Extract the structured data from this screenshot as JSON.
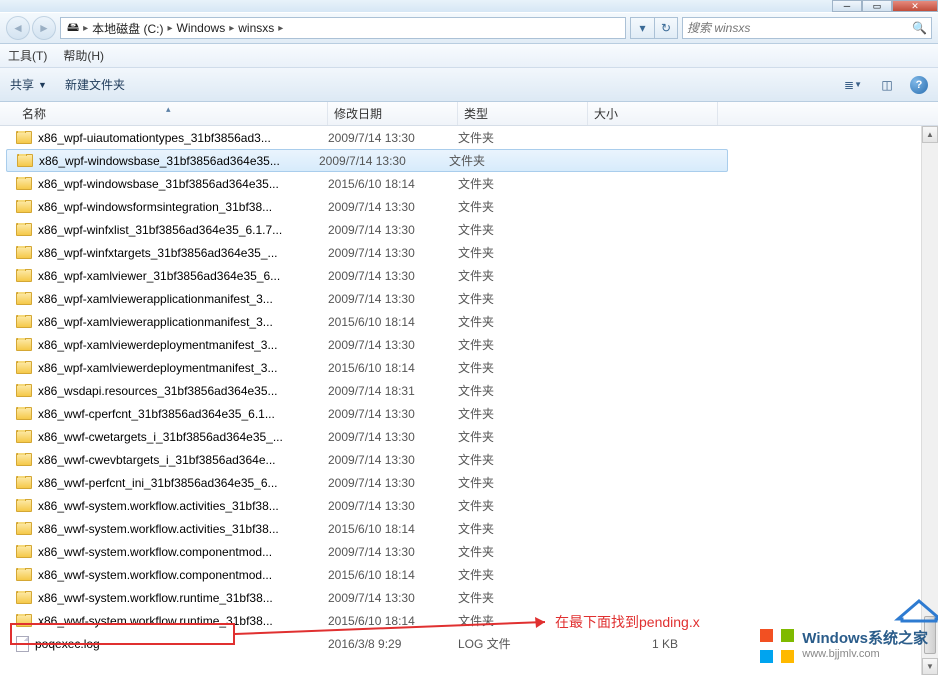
{
  "breadcrumb": {
    "seg1": "本地磁盘 (C:)",
    "seg2": "Windows",
    "seg3": "winsxs"
  },
  "search": {
    "placeholder": "搜索 winsxs"
  },
  "menu": {
    "tools": "工具(T)",
    "help": "帮助(H)"
  },
  "toolbar": {
    "share": "共享",
    "newfolder": "新建文件夹"
  },
  "columns": {
    "name": "名称",
    "date": "修改日期",
    "type": "类型",
    "size": "大小"
  },
  "type_folder": "文件夹",
  "type_log": "LOG 文件",
  "rows": [
    {
      "name": "x86_wpf-uiautomationtypes_31bf3856ad3...",
      "date": "2009/7/14 13:30",
      "type": "文件夹",
      "size": "",
      "icon": "folder"
    },
    {
      "name": "x86_wpf-windowsbase_31bf3856ad364e35...",
      "date": "2009/7/14 13:30",
      "type": "文件夹",
      "size": "",
      "icon": "folder",
      "selected": true
    },
    {
      "name": "x86_wpf-windowsbase_31bf3856ad364e35...",
      "date": "2015/6/10 18:14",
      "type": "文件夹",
      "size": "",
      "icon": "folder"
    },
    {
      "name": "x86_wpf-windowsformsintegration_31bf38...",
      "date": "2009/7/14 13:30",
      "type": "文件夹",
      "size": "",
      "icon": "folder"
    },
    {
      "name": "x86_wpf-winfxlist_31bf3856ad364e35_6.1.7...",
      "date": "2009/7/14 13:30",
      "type": "文件夹",
      "size": "",
      "icon": "folder"
    },
    {
      "name": "x86_wpf-winfxtargets_31bf3856ad364e35_...",
      "date": "2009/7/14 13:30",
      "type": "文件夹",
      "size": "",
      "icon": "folder"
    },
    {
      "name": "x86_wpf-xamlviewer_31bf3856ad364e35_6...",
      "date": "2009/7/14 13:30",
      "type": "文件夹",
      "size": "",
      "icon": "folder"
    },
    {
      "name": "x86_wpf-xamlviewerapplicationmanifest_3...",
      "date": "2009/7/14 13:30",
      "type": "文件夹",
      "size": "",
      "icon": "folder"
    },
    {
      "name": "x86_wpf-xamlviewerapplicationmanifest_3...",
      "date": "2015/6/10 18:14",
      "type": "文件夹",
      "size": "",
      "icon": "folder"
    },
    {
      "name": "x86_wpf-xamlviewerdeploymentmanifest_3...",
      "date": "2009/7/14 13:30",
      "type": "文件夹",
      "size": "",
      "icon": "folder"
    },
    {
      "name": "x86_wpf-xamlviewerdeploymentmanifest_3...",
      "date": "2015/6/10 18:14",
      "type": "文件夹",
      "size": "",
      "icon": "folder"
    },
    {
      "name": "x86_wsdapi.resources_31bf3856ad364e35...",
      "date": "2009/7/14 18:31",
      "type": "文件夹",
      "size": "",
      "icon": "folder"
    },
    {
      "name": "x86_wwf-cperfcnt_31bf3856ad364e35_6.1...",
      "date": "2009/7/14 13:30",
      "type": "文件夹",
      "size": "",
      "icon": "folder"
    },
    {
      "name": "x86_wwf-cwetargets_i_31bf3856ad364e35_...",
      "date": "2009/7/14 13:30",
      "type": "文件夹",
      "size": "",
      "icon": "folder"
    },
    {
      "name": "x86_wwf-cwevbtargets_i_31bf3856ad364e...",
      "date": "2009/7/14 13:30",
      "type": "文件夹",
      "size": "",
      "icon": "folder"
    },
    {
      "name": "x86_wwf-perfcnt_ini_31bf3856ad364e35_6...",
      "date": "2009/7/14 13:30",
      "type": "文件夹",
      "size": "",
      "icon": "folder"
    },
    {
      "name": "x86_wwf-system.workflow.activities_31bf38...",
      "date": "2009/7/14 13:30",
      "type": "文件夹",
      "size": "",
      "icon": "folder"
    },
    {
      "name": "x86_wwf-system.workflow.activities_31bf38...",
      "date": "2015/6/10 18:14",
      "type": "文件夹",
      "size": "",
      "icon": "folder"
    },
    {
      "name": "x86_wwf-system.workflow.componentmod...",
      "date": "2009/7/14 13:30",
      "type": "文件夹",
      "size": "",
      "icon": "folder"
    },
    {
      "name": "x86_wwf-system.workflow.componentmod...",
      "date": "2015/6/10 18:14",
      "type": "文件夹",
      "size": "",
      "icon": "folder"
    },
    {
      "name": "x86_wwf-system.workflow.runtime_31bf38...",
      "date": "2009/7/14 13:30",
      "type": "文件夹",
      "size": "",
      "icon": "folder"
    },
    {
      "name": "x86_wwf-system.workflow.runtime_31bf38...",
      "date": "2015/6/10 18:14",
      "type": "文件夹",
      "size": "",
      "icon": "folder"
    },
    {
      "name": "poqexec.log",
      "date": "2016/3/8 9:29",
      "type": "LOG 文件",
      "size": "1 KB",
      "icon": "file"
    }
  ],
  "annotation": {
    "text": "在最下面找到pending.x"
  },
  "watermark": {
    "title": "Windows系统之家",
    "url": "www.bjjmlv.com"
  }
}
